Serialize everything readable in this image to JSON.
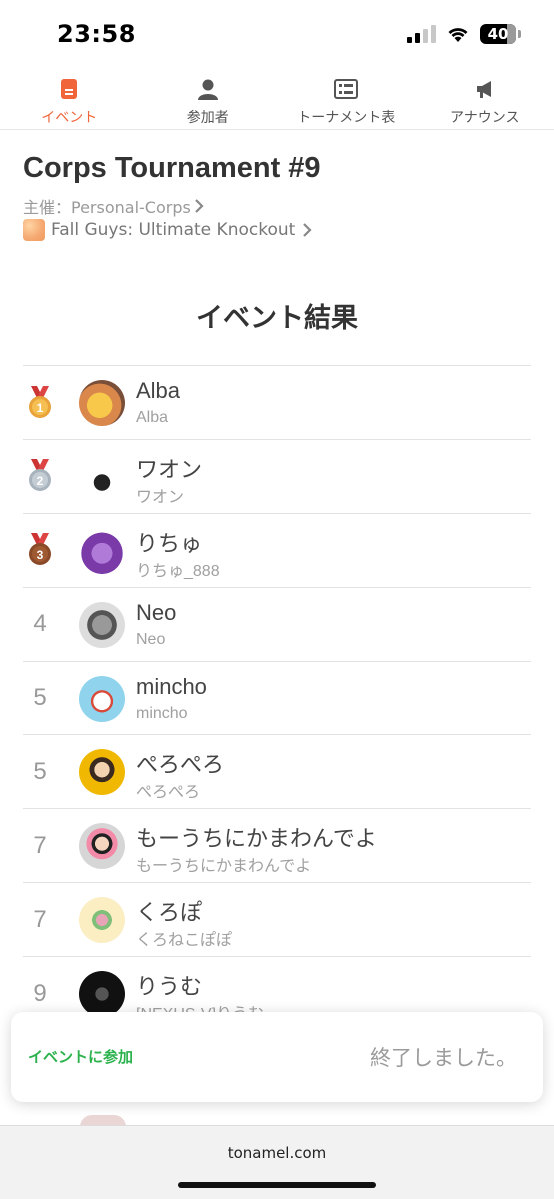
{
  "status_bar": {
    "time": "23:58",
    "battery": "40"
  },
  "tabs": [
    {
      "label": "イベント",
      "icon": "event-icon",
      "active": true
    },
    {
      "label": "参加者",
      "icon": "person-icon",
      "active": false
    },
    {
      "label": "トーナメント表",
      "icon": "bracket-icon",
      "active": false
    },
    {
      "label": "アナウンス",
      "icon": "megaphone-icon",
      "active": false
    }
  ],
  "event": {
    "title": "Corps Tournament #9",
    "organizer": "主催：Personal-Corps",
    "game": "Fall Guys: Ultimate Knockout"
  },
  "results": {
    "title": "イベント結果",
    "rows": [
      {
        "rank": "1",
        "medal": "gold",
        "name": "Alba",
        "sub": "Alba"
      },
      {
        "rank": "2",
        "medal": "silver",
        "name": "ワオン",
        "sub": "ワオン"
      },
      {
        "rank": "3",
        "medal": "bronze",
        "name": "りちゅ",
        "sub": "りちゅ_888"
      },
      {
        "rank": "4",
        "name": "Neo",
        "sub": "Neo"
      },
      {
        "rank": "5",
        "name": "mincho",
        "sub": "mincho"
      },
      {
        "rank": "5",
        "name": "ぺろぺろ",
        "sub": "ぺろぺろ"
      },
      {
        "rank": "7",
        "name": "もーうちにかまわんでよ",
        "sub": "もーうちにかまわんでよ"
      },
      {
        "rank": "7",
        "name": "くろぽ",
        "sub": "くろねこぽぽ"
      },
      {
        "rank": "9",
        "name": "りうむ",
        "sub": "[NEXUS-V]りうむ"
      }
    ]
  },
  "join_bar": {
    "join_label": "イベントに参加",
    "status": "終了しました。"
  },
  "browser": {
    "url": "tonamel.com"
  },
  "colors": {
    "accent": "#f0653a",
    "join": "#2bb24c",
    "gold": "#e8a33a",
    "silver": "#a8b3bd",
    "bronze": "#a05a32"
  }
}
